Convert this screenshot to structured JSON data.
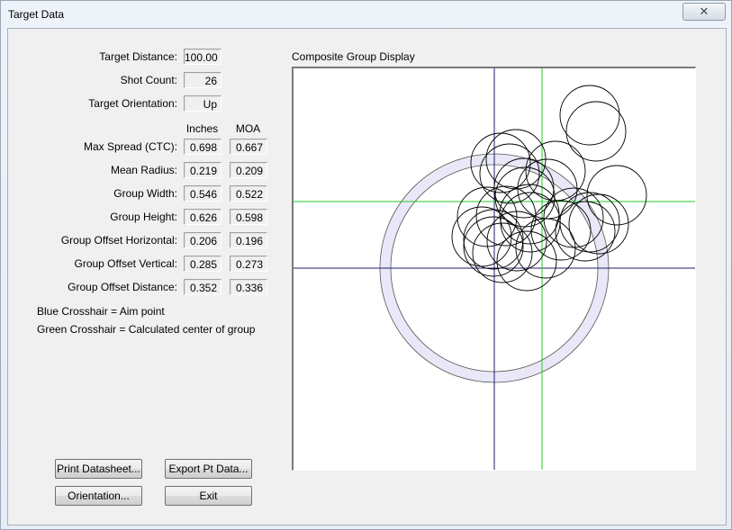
{
  "window": {
    "title": "Target Data",
    "close_symbol": "✕"
  },
  "info": {
    "target_distance": {
      "label": "Target Distance:",
      "value": "100.00"
    },
    "shot_count": {
      "label": "Shot Count:",
      "value": "26"
    },
    "target_orientation": {
      "label": "Target Orientation:",
      "value": "Up"
    }
  },
  "columns": {
    "inches": "Inches",
    "moa": "MOA"
  },
  "stats": [
    {
      "label": "Max Spread (CTC):",
      "inches": "0.698",
      "moa": "0.667"
    },
    {
      "label": "Mean Radius:",
      "inches": "0.219",
      "moa": "0.209"
    },
    {
      "label": "Group Width:",
      "inches": "0.546",
      "moa": "0.522"
    },
    {
      "label": "Group Height:",
      "inches": "0.626",
      "moa": "0.598"
    },
    {
      "label": "Group Offset Horizontal:",
      "inches": "0.206",
      "moa": "0.196"
    },
    {
      "label": "Group Offset Vertical:",
      "inches": "0.285",
      "moa": "0.273"
    },
    {
      "label": "Group Offset Distance:",
      "inches": "0.352",
      "moa": "0.336"
    }
  ],
  "legend": {
    "blue": "Blue Crosshair = Aim point",
    "green": "Green Crosshair = Calculated center of group"
  },
  "buttons": {
    "print_datasheet": "Print Datasheet...",
    "export_pt_data": "Export Pt Data...",
    "orientation": "Orientation...",
    "exit": "Exit"
  },
  "display": {
    "label": "Composite Group Display",
    "colors": {
      "aim_crosshair": "#1e1e6e",
      "center_crosshair": "#22cc22",
      "target_ring": "#e8e8f8",
      "shot_stroke": "#000000"
    }
  }
}
